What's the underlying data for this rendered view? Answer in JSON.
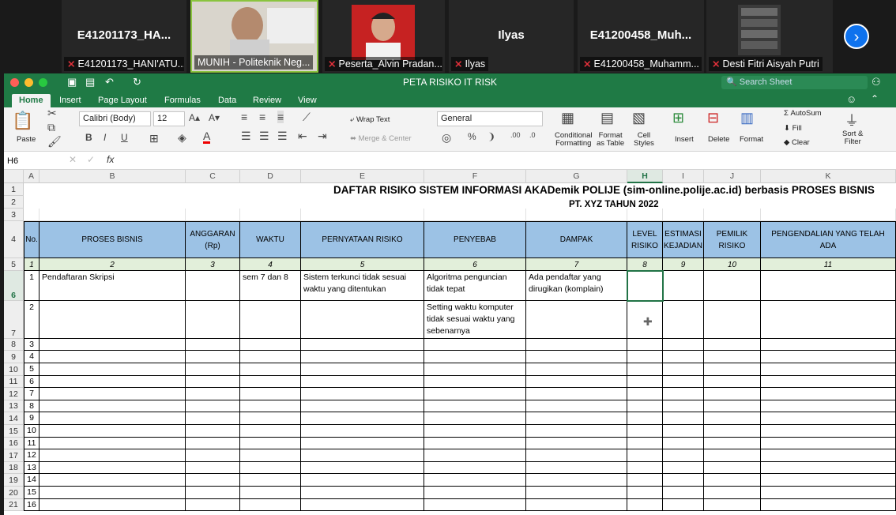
{
  "zoom": {
    "tiles": [
      {
        "big": "E41201173_HA...",
        "cap": "E41201173_HANI'ATU..."
      },
      {
        "big": "",
        "cap": "MUNIH - Politeknik Neg..."
      },
      {
        "big": "",
        "cap": "Peserta_Alvin Pradan..."
      },
      {
        "big": "Ilyas",
        "cap": "Ilyas"
      },
      {
        "big": "E41200458_Muh...",
        "cap": "E41200458_Muhamm..."
      },
      {
        "big": "",
        "cap": "Desti Fitri Aisyah Putri"
      }
    ],
    "next_icon": "›"
  },
  "excel": {
    "title": "PETA RISIKO IT RISK",
    "search_placeholder": "Search Sheet",
    "tabs": [
      "Home",
      "Insert",
      "Page Layout",
      "Formulas",
      "Data",
      "Review",
      "View"
    ],
    "ribbon": {
      "paste": "Paste",
      "font": "Calibri (Body)",
      "size": "12",
      "bold": "B",
      "italic": "I",
      "underline": "U",
      "wrap": "Wrap Text",
      "merge": "Merge & Center",
      "numformat": "General",
      "cond": "Conditional",
      "cond2": "Formatting",
      "fmt_table": "Format",
      "fmt_table2": "as Table",
      "cell_styles": "Cell",
      "cell_styles2": "Styles",
      "insert": "Insert",
      "delete": "Delete",
      "format": "Format",
      "autosum": "AutoSum",
      "fill": "Fill",
      "clear": "Clear",
      "sort": "Sort &",
      "sort2": "Filter"
    },
    "namebox": "H6",
    "fx": "fx",
    "columns": [
      "A",
      "B",
      "C",
      "D",
      "E",
      "F",
      "G",
      "H",
      "I",
      "J",
      "K"
    ],
    "rows": [
      "1",
      "2",
      "3",
      "4",
      "5",
      "6",
      "7",
      "8",
      "9",
      "10",
      "11",
      "12",
      "13",
      "14",
      "15",
      "16",
      "17",
      "18",
      "19",
      "20",
      "21"
    ],
    "title1": "DAFTAR RISIKO SISTEM INFORMASI AKADemik POLIJE  (sim-online.polije.ac.id) berbasis  PROSES BISNIS",
    "title2": "PT. XYZ  TAHUN  2022",
    "headers": [
      "No.",
      "PROSES BISNIS",
      "ANGGARAN (Rp)",
      "WAKTU",
      "PERNYATAAN RISIKO",
      "PENYEBAB",
      "DAMPAK",
      "LEVEL RISIKO",
      "ESTIMASI KEJADIAN",
      "PEMILIK RISIKO",
      "PENGENDALIAN YANG TELAH ADA"
    ],
    "numrow": [
      "1",
      "2",
      "3",
      "4",
      "5",
      "6",
      "7",
      "8",
      "9",
      "10",
      "11"
    ],
    "r6": {
      "no": "1",
      "proses": "Pendaftaran Skripsi",
      "waktu": "sem 7 dan 8",
      "pernyataan": "Sistem terkunci tidak sesuai waktu yang ditentukan",
      "penyebab": "Algoritma penguncian tidak tepat",
      "dampak": "Ada pendaftar yang dirugikan (komplain)"
    },
    "r7": {
      "no": "2",
      "penyebab": "Setting waktu komputer tidak sesuai waktu yang sebenarnya"
    },
    "seq": [
      "3",
      "4",
      "5",
      "6",
      "7",
      "8",
      "9",
      "10",
      "11",
      "12",
      "13",
      "14",
      "15",
      "16"
    ]
  }
}
